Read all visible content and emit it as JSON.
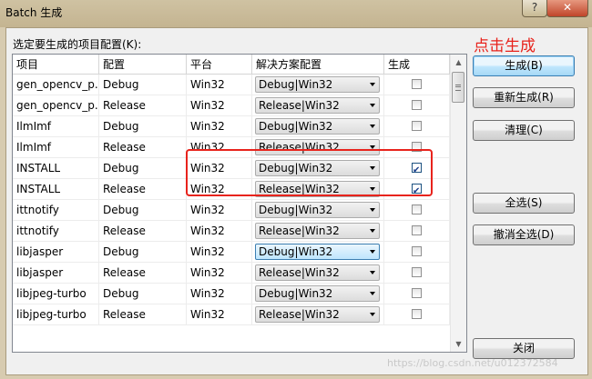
{
  "window": {
    "title": "Batch 生成",
    "help_glyph": "?",
    "close_glyph": "✕"
  },
  "select_label": "选定要生成的项目配置(K):",
  "columns": [
    "项目",
    "配置",
    "平台",
    "解决方案配置",
    "生成"
  ],
  "rows": [
    {
      "project": "gen_opencv_p...",
      "config": "Debug",
      "platform": "Win32",
      "solution_config": "Debug|Win32",
      "build": false
    },
    {
      "project": "gen_opencv_p...",
      "config": "Release",
      "platform": "Win32",
      "solution_config": "Release|Win32",
      "build": false
    },
    {
      "project": "IlmImf",
      "config": "Debug",
      "platform": "Win32",
      "solution_config": "Debug|Win32",
      "build": false
    },
    {
      "project": "IlmImf",
      "config": "Release",
      "platform": "Win32",
      "solution_config": "Release|Win32",
      "build": false
    },
    {
      "project": "INSTALL",
      "config": "Debug",
      "platform": "Win32",
      "solution_config": "Debug|Win32",
      "build": true
    },
    {
      "project": "INSTALL",
      "config": "Release",
      "platform": "Win32",
      "solution_config": "Release|Win32",
      "build": true
    },
    {
      "project": "ittnotify",
      "config": "Debug",
      "platform": "Win32",
      "solution_config": "Debug|Win32",
      "build": false
    },
    {
      "project": "ittnotify",
      "config": "Release",
      "platform": "Win32",
      "solution_config": "Release|Win32",
      "build": false
    },
    {
      "project": "libjasper",
      "config": "Debug",
      "platform": "Win32",
      "solution_config": "Debug|Win32",
      "build": false,
      "focused": true
    },
    {
      "project": "libjasper",
      "config": "Release",
      "platform": "Win32",
      "solution_config": "Release|Win32",
      "build": false
    },
    {
      "project": "libjpeg-turbo",
      "config": "Debug",
      "platform": "Win32",
      "solution_config": "Debug|Win32",
      "build": false
    },
    {
      "project": "libjpeg-turbo",
      "config": "Release",
      "platform": "Win32",
      "solution_config": "Release|Win32",
      "build": false
    }
  ],
  "buttons": {
    "build": "生成(B)",
    "rebuild": "重新生成(R)",
    "clean": "清理(C)",
    "select_all": "全选(S)",
    "deselect_all": "撤消全选(D)",
    "close": "关闭"
  },
  "annotation": {
    "text": "点击生成",
    "color": "#e8231c"
  },
  "watermark": "https://blog.csdn.net/u012372584"
}
